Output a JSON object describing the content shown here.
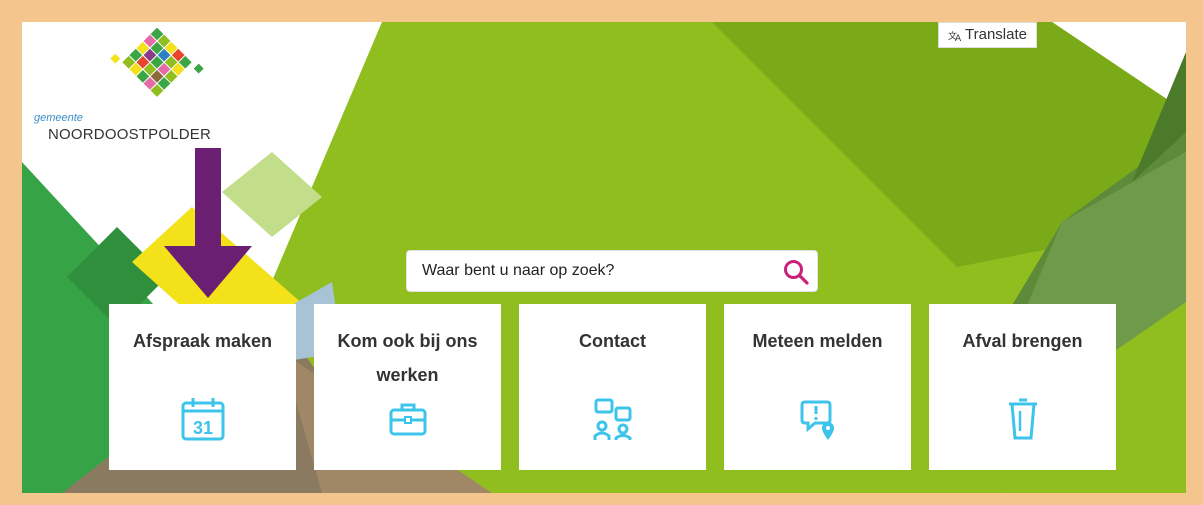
{
  "header": {
    "logo_small": "gemeente",
    "logo_big": "NOORDOOSTPOLDER",
    "translate_label": "Translate",
    "translate_icon": "translate-icon"
  },
  "search": {
    "placeholder": "Waar bent u naar op zoek?",
    "icon": "search-icon"
  },
  "tiles": [
    {
      "label": "Afspraak maken",
      "icon": "calendar-icon",
      "calendar_day": "31"
    },
    {
      "label": "Kom ook bij ons werken",
      "icon": "briefcase-icon"
    },
    {
      "label": "Contact",
      "icon": "contact-chat-icon"
    },
    {
      "label": "Meteen melden",
      "icon": "report-location-icon"
    },
    {
      "label": "Afval brengen",
      "icon": "trash-bin-icon"
    }
  ],
  "colors": {
    "lime": "#8fbe1e",
    "dark_green": "#3aa645",
    "purple_arrow": "#6b1f73",
    "accent_magenta": "#c9207b",
    "icon_blue": "#3cc4ea"
  }
}
